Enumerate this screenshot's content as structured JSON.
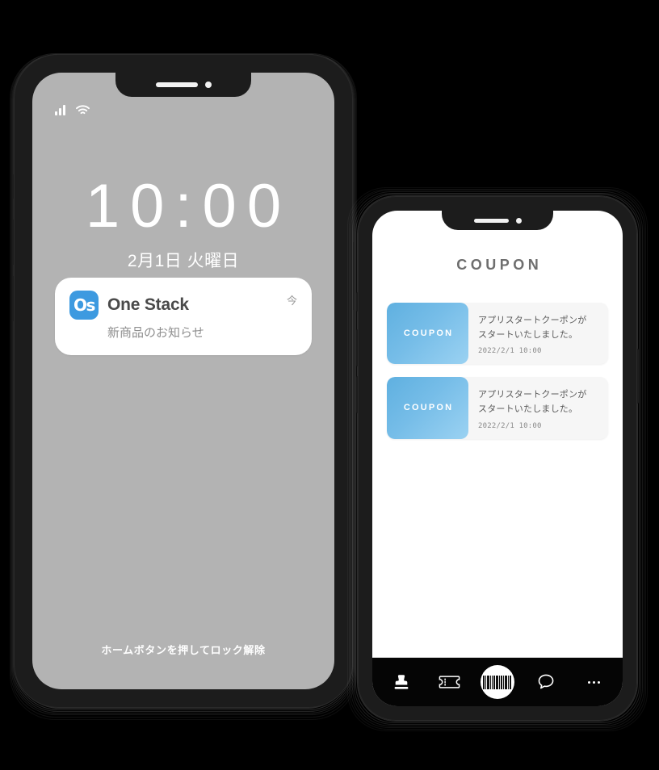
{
  "lock_phone": {
    "status_bar": {
      "signal_icon": "signal-bars-icon",
      "wifi_icon": "wifi-icon"
    },
    "clock": {
      "time": "10:00",
      "date": "2月1日 火曜日"
    },
    "notification": {
      "app_icon_text": "Os",
      "app_name": "One Stack",
      "timestamp": "今",
      "message": "新商品のお知らせ"
    },
    "unlock_hint": "ホームボタンを押してロック解除"
  },
  "app_phone": {
    "header_title": "COUPON",
    "coupons": [
      {
        "thumb_label": "COUPON",
        "title": "アプリスタートクーポンが\nスタートいたしました。",
        "title_line1": "アプリスタートクーポンが",
        "title_line2": "スタートいたしました。",
        "date": "2022/2/1 10:00"
      },
      {
        "thumb_label": "COUPON",
        "title": "アプリスタートクーポンが\nスタートいたしました。",
        "title_line1": "アプリスタートクーポンが",
        "title_line2": "スタートいたしました。",
        "date": "2022/2/1 10:00"
      }
    ],
    "tabbar": [
      {
        "icon": "stamp-icon",
        "label": ""
      },
      {
        "icon": "ticket-icon",
        "label": ""
      },
      {
        "icon": "barcode-icon",
        "label": ""
      },
      {
        "icon": "chat-bubble-icon",
        "label": ""
      },
      {
        "icon": "ellipsis-icon",
        "label": ""
      }
    ]
  },
  "colors": {
    "page_background": "#000000",
    "lock_screen_background": "#b3b3b3",
    "phone_frame": "#1c1c1c",
    "app_icon_blue": "#3d9ae0",
    "coupon_gradient_start": "#5fb0e0",
    "coupon_gradient_end": "#9bd2f2",
    "coupon_card_background": "#f6f6f6",
    "tabbar_background": "#050505"
  }
}
